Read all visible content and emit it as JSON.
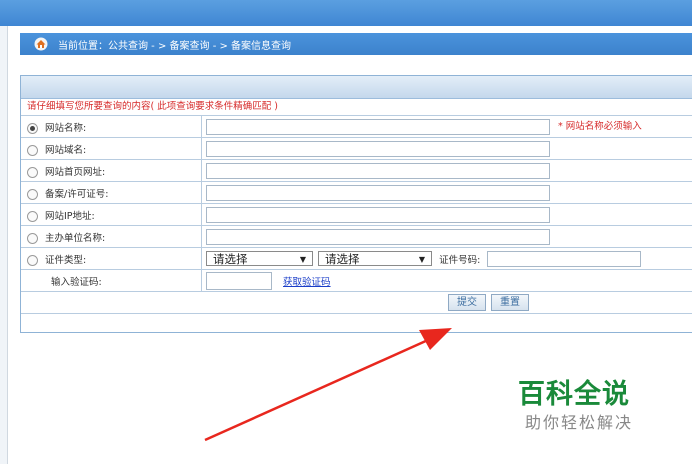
{
  "breadcrumb": {
    "label": "当前位置：公共查询  - >  备案查询  - > 备案信息查询"
  },
  "form": {
    "hint": "请仔细填写您所要查询的内容( 此项查询要求条件精确匹配 )",
    "rows": [
      {
        "label": "网站名称:",
        "selected": true
      },
      {
        "label": "网站域名:",
        "selected": false
      },
      {
        "label": "网站首页网址:",
        "selected": false
      },
      {
        "label": "备案/许可证号:",
        "selected": false
      },
      {
        "label": "网站IP地址:",
        "selected": false
      },
      {
        "label": "主办单位名称:",
        "selected": false
      },
      {
        "label": "证件类型:",
        "selected": false
      }
    ],
    "required_note": "* 网站名称必须输入",
    "select1": "请选择",
    "select2": "请选择",
    "cert_number_label": "证件号码:",
    "captcha_label": "输入验证码:",
    "captcha_link": "获取验证码",
    "submit": "提交",
    "reset": "重置"
  },
  "watermark": {
    "title": "百科全说",
    "subtitle": "助你轻松解决"
  },
  "colors": {
    "header_blue": "#3f86d3",
    "hint_red": "#d62a2a",
    "arrow_red": "#e8271e",
    "brand_green": "#1a8a3a"
  }
}
